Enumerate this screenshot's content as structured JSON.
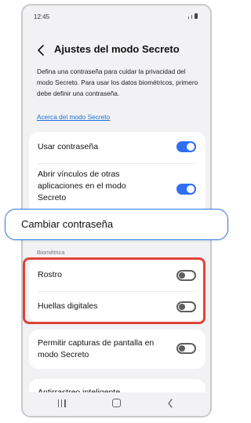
{
  "status_bar": {
    "time": "12:45"
  },
  "header": {
    "title": "Ajustes del modo Secreto"
  },
  "description": {
    "text": "Defina una contraseña para cuidar la privacidad del modo Secreto. Para usar los datos biométricos, primero debe definir una contraseña.",
    "link": "Acerca del modo Secreto"
  },
  "settings": {
    "use_password": {
      "label": "Usar contraseña",
      "enabled": true
    },
    "open_links": {
      "label": "Abrir vínculos de otras aplicaciones en el modo Secreto",
      "enabled": true
    },
    "change_password": {
      "label": "Cambiar contraseña"
    }
  },
  "biometrics": {
    "section_label": "Biométrica",
    "face": {
      "label": "Rostro",
      "enabled": false
    },
    "fingerprints": {
      "label": "Huellas digitales",
      "enabled": false
    }
  },
  "screenshots": {
    "label": "Permitir capturas de pantalla en modo Secreto",
    "enabled": false
  },
  "anti_tracking": {
    "label": "Antirrastreo inteligente"
  },
  "colors": {
    "accent": "#2f6ff3",
    "link": "#1a6fd8",
    "highlight": "#e0443a",
    "callout_border": "#2d7ce8"
  }
}
